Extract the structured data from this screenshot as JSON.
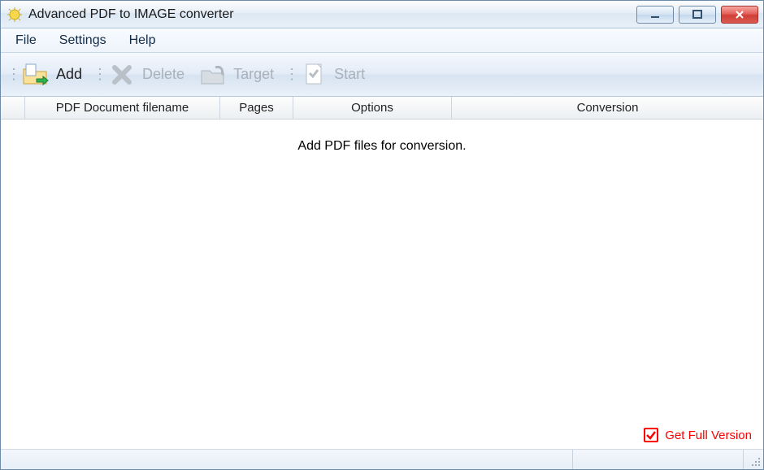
{
  "window": {
    "title": "Advanced PDF to IMAGE converter"
  },
  "menu": {
    "file": "File",
    "settings": "Settings",
    "help": "Help"
  },
  "toolbar": {
    "add": "Add",
    "delete": "Delete",
    "target": "Target",
    "start": "Start"
  },
  "columns": {
    "filename": "PDF Document filename",
    "pages": "Pages",
    "options": "Options",
    "conversion": "Conversion"
  },
  "main": {
    "placeholder": "Add PDF files for conversion."
  },
  "footer": {
    "get_full": "Get Full Version"
  }
}
